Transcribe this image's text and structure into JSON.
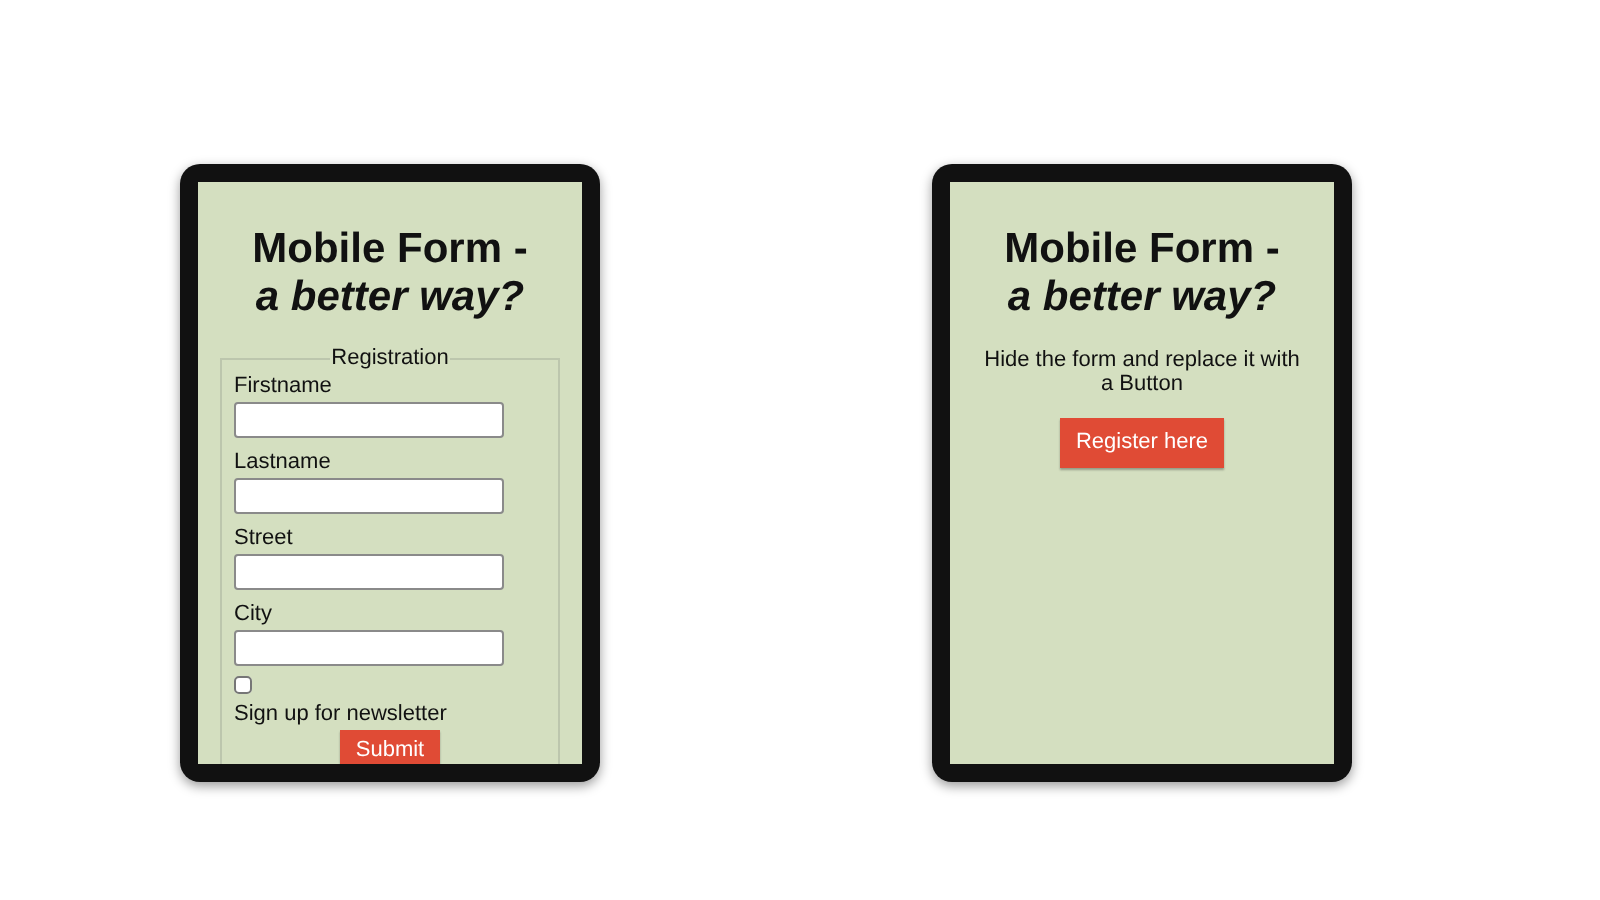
{
  "phones": [
    {
      "kind": "form",
      "title": "Mobile Form -",
      "subtitle": "a better way?",
      "form": {
        "legend": "Registration",
        "fields": [
          {
            "label": "Firstname"
          },
          {
            "label": "Lastname"
          },
          {
            "label": "Street"
          },
          {
            "label": "City"
          }
        ],
        "checkbox": {
          "label": "Sign up for newsletter",
          "checked": false
        },
        "submit": "Submit"
      }
    },
    {
      "kind": "cta",
      "title": "Mobile Form -",
      "subtitle": "a better way?",
      "text": "Hide the form and replace it with a Button",
      "button": "Register here"
    }
  ]
}
